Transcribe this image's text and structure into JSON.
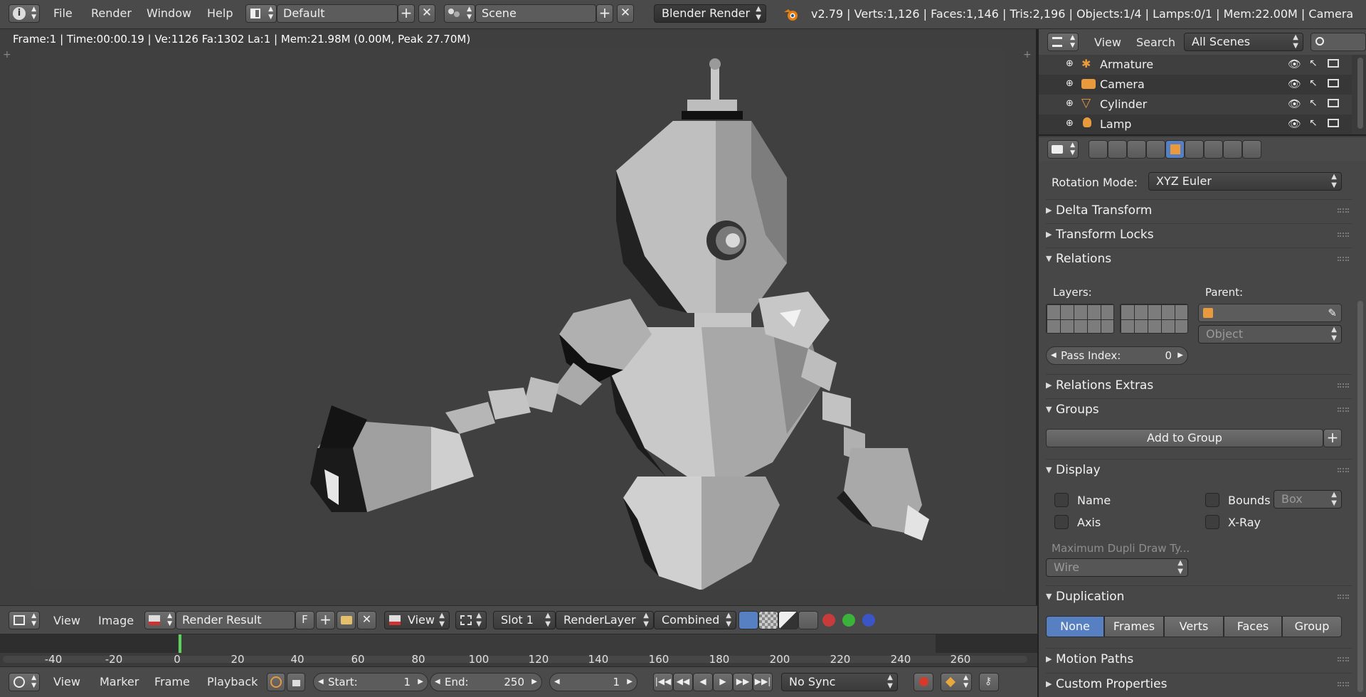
{
  "topbar": {
    "menus": [
      "File",
      "Render",
      "Window",
      "Help"
    ],
    "layout_name": "Default",
    "scene_name": "Scene",
    "render_engine": "Blender Render",
    "stats": "v2.79 | Verts:1,126 | Faces:1,146 | Tris:2,196 | Objects:1/4 | Lamps:0/1 | Mem:22.00M | Camera"
  },
  "viewport": {
    "info": "Frame:1 | Time:00:00.19 | Ve:1126 Fa:1302 La:1 | Mem:21.98M (0.00M, Peak 27.70M)"
  },
  "outliner": {
    "menu_view": "View",
    "menu_search": "Search",
    "scene_filter": "All Scenes",
    "items": [
      {
        "label": "Armature"
      },
      {
        "label": "Camera"
      },
      {
        "label": "Cylinder"
      },
      {
        "label": "Lamp"
      }
    ]
  },
  "properties": {
    "rotation_mode_label": "Rotation Mode:",
    "rotation_mode_value": "XYZ Euler",
    "panels": {
      "delta_transform": "Delta Transform",
      "transform_locks": "Transform Locks",
      "relations": "Relations",
      "relations_extras": "Relations Extras",
      "groups": "Groups",
      "display": "Display",
      "duplication": "Duplication",
      "motion_paths": "Motion Paths",
      "custom_properties": "Custom Properties"
    },
    "relations": {
      "layers_label": "Layers:",
      "parent_label": "Parent:",
      "parent_type": "Object",
      "pass_index_label": "Pass Index:",
      "pass_index_value": "0"
    },
    "groups": {
      "add_button": "Add to Group"
    },
    "display": {
      "name": "Name",
      "axis": "Axis",
      "bounds": "Bounds",
      "bounds_type": "Box",
      "xray": "X-Ray",
      "max_dupli_label": "Maximum Dupli Draw Ty...",
      "max_dupli_value": "Wire"
    },
    "duplication": {
      "options": [
        "None",
        "Frames",
        "Verts",
        "Faces",
        "Group"
      ],
      "selected": "None"
    }
  },
  "image_header": {
    "menu_view": "View",
    "menu_image": "Image",
    "image_name": "Render Result",
    "fake_user": "F",
    "view_mode": "View",
    "slot": "Slot 1",
    "render_layer": "RenderLayer",
    "pass": "Combined"
  },
  "timeline": {
    "ticks": [
      "-40",
      "-20",
      "0",
      "20",
      "40",
      "60",
      "80",
      "100",
      "120",
      "140",
      "160",
      "180",
      "200",
      "220",
      "240",
      "260"
    ],
    "menu_view": "View",
    "menu_marker": "Marker",
    "menu_frame": "Frame",
    "menu_playback": "Playback",
    "start_label": "Start:",
    "start_value": "1",
    "end_label": "End:",
    "end_value": "250",
    "current_frame": "1",
    "sync": "No Sync"
  },
  "colors": {
    "accent_blue": "#5680c2",
    "orange_icon": "#e89a3c",
    "header_bg": "#4a4a4a",
    "frame_marker": "#5ad35a"
  }
}
